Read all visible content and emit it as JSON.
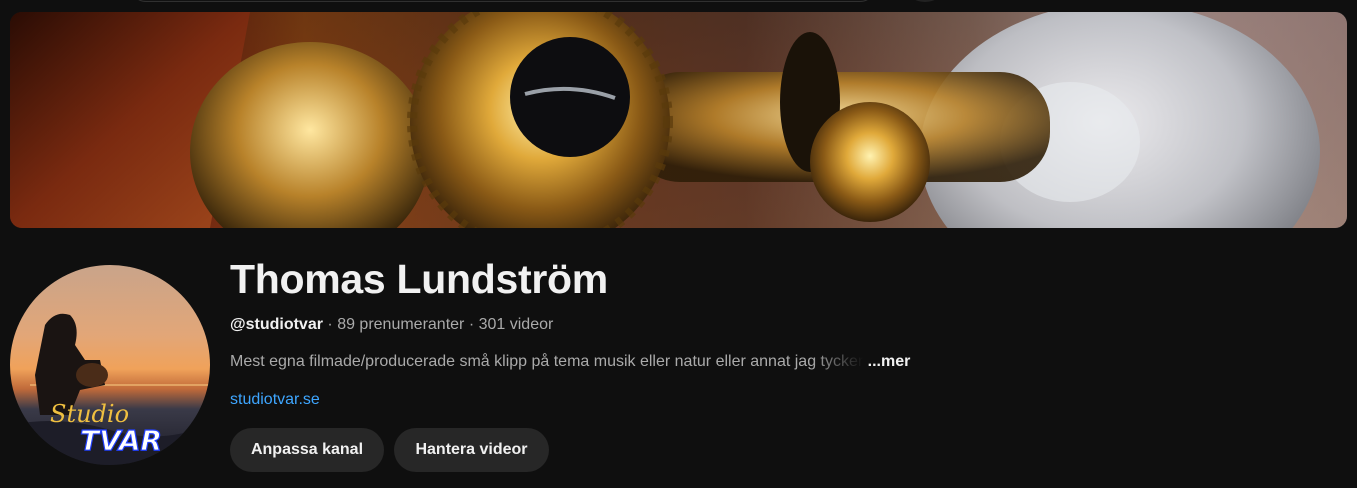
{
  "channel": {
    "name": "Thomas Lundström",
    "handle": "@studiotvar",
    "separator": "·",
    "subscribers": "89 prenumeranter",
    "videos": "301 videor",
    "description": "Mest egna filmade/producerade små klipp på tema musik eller natur eller annat jag tycker",
    "more_label": "...mer",
    "link": "studiotvar.se",
    "avatar_text": {
      "line1": "Studio",
      "line2": "TVAR"
    }
  },
  "actions": {
    "customize_label": "Anpassa kanal",
    "manage_label": "Hantera videor"
  },
  "colors": {
    "background": "#0f0f0f",
    "button_bg": "#272727",
    "link": "#3ea6ff",
    "secondary_text": "#aaaaaa"
  }
}
